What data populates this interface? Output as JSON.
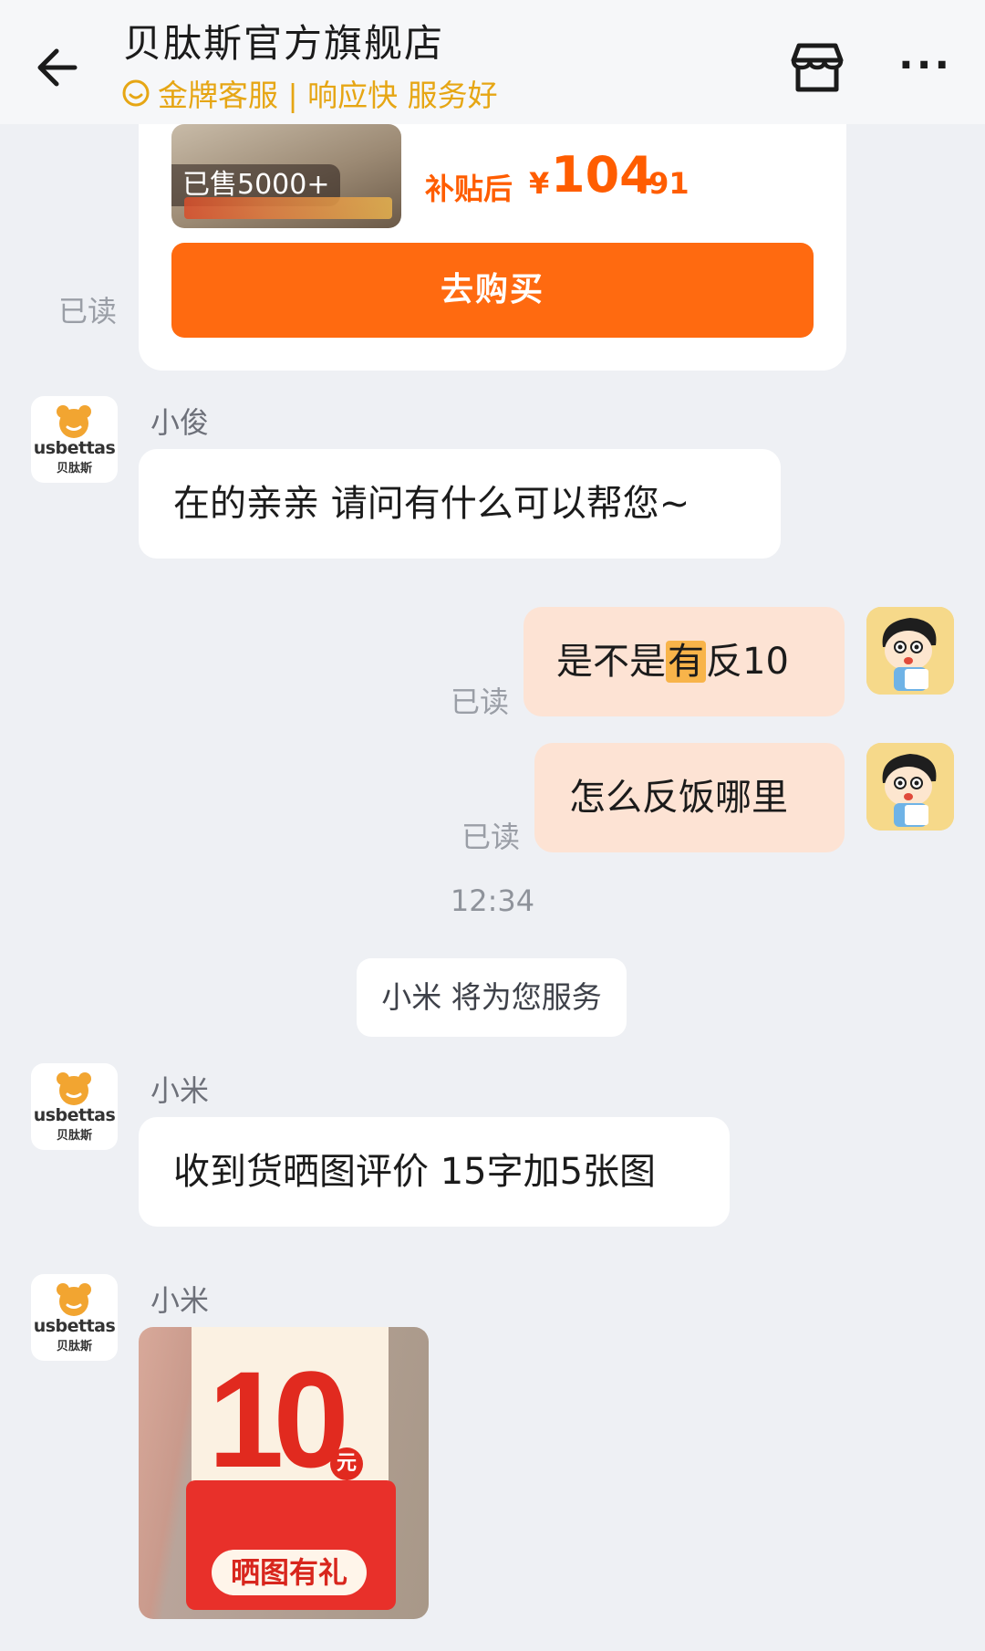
{
  "header": {
    "title": "贝肽斯官方旗舰店",
    "subtitle": "金牌客服 | 响应快 服务好",
    "more_label": "···"
  },
  "product": {
    "sold_badge": "已售5000+",
    "price_label": "补贴后",
    "currency": "¥",
    "price_int": "104",
    "price_dec": ".91",
    "buy_label": "去购买"
  },
  "read_label": "已读",
  "shop_avatar": {
    "brand": "usbettas",
    "brand_cn": "贝肽斯"
  },
  "messages": {
    "m1": {
      "sender": "小俊",
      "text": "在的亲亲  请问有什么可以帮您~"
    },
    "m2": {
      "text_before": "是不是",
      "text_highlight": "有",
      "text_after": "反10"
    },
    "m3": {
      "text": "怎么反饭哪里"
    },
    "time": "12:34",
    "system": "小米 将为您服务",
    "m4": {
      "sender": "小米",
      "text": "收到货晒图评价 15字加5张图"
    },
    "m5": {
      "sender": "小米",
      "image_value": "10",
      "image_unit": "元",
      "image_tag": "晒图有礼"
    }
  },
  "colors": {
    "accent_orange": "#ff6a10",
    "gold": "#e6a614",
    "outgoing_bubble": "#fde3d4",
    "background": "#eef0f4"
  }
}
